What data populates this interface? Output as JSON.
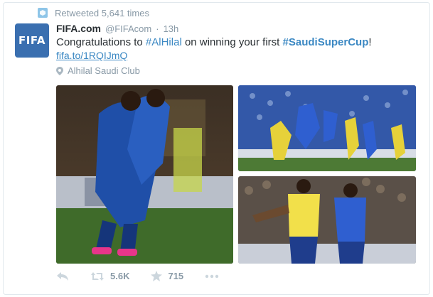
{
  "colors": {
    "link": "#3b88c3",
    "muted": "#8899a6",
    "text": "#292f33",
    "avatar_bg": "#3a6fb0"
  },
  "retweet": {
    "icon": "retweet-icon",
    "text": "Retweeted 5,641 times"
  },
  "author": {
    "avatar_text": "FIFA",
    "name": "FIFA.com",
    "handle": "@FIFAcom",
    "separator": "·",
    "time": "13h"
  },
  "tweet": {
    "text_pre": "Congratulations to ",
    "hashtag1": "#AlHilal",
    "text_mid": " on winning your first ",
    "hashtag2": "#SaudiSuperCup",
    "text_end": "!",
    "link": "fifa.to/1RQIJmQ"
  },
  "location": {
    "icon": "location-pin-icon",
    "text": "Alhilal Saudi Club"
  },
  "media": [
    {
      "name": "photo-players-hugging"
    },
    {
      "name": "photo-header-jump"
    },
    {
      "name": "photo-ball-duel"
    }
  ],
  "actions": {
    "reply": {
      "icon": "reply-icon"
    },
    "retweet": {
      "icon": "retweet-icon",
      "count": "5.6K"
    },
    "favorite": {
      "icon": "star-icon",
      "count": "715"
    },
    "more": {
      "icon": "more-icon"
    }
  }
}
